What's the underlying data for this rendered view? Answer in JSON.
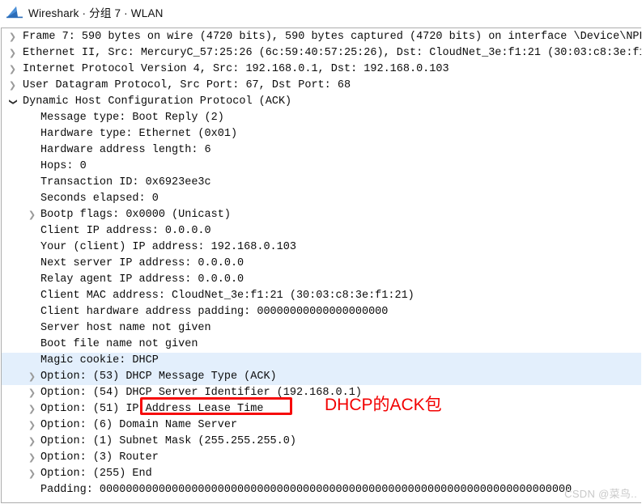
{
  "window": {
    "title": "Wireshark · 分组 7 · WLAN",
    "logo_icon": "wireshark-shark-fin-icon"
  },
  "accent_colors": {
    "selection_blue": "#e3effc",
    "annotation_red": "#f20000",
    "border_gray": "#adadad",
    "chevron_gray": "#9a9a9a",
    "watermark_gray": "#c9c9c9"
  },
  "annotation": {
    "note_text": "DHCP的ACK包",
    "box_target": "DHCP Message Type (ACK)"
  },
  "watermark": {
    "text": "CSDN @菜鸟.."
  },
  "tree": {
    "rows": [
      {
        "depth": 0,
        "toggle": "collapsed",
        "selected": false,
        "text": "Frame 7: 590 bytes on wire (4720 bits), 590 bytes captured (4720 bits) on interface \\Device\\NPF_"
      },
      {
        "depth": 0,
        "toggle": "collapsed",
        "selected": false,
        "text": "Ethernet II, Src: MercuryC_57:25:26 (6c:59:40:57:25:26), Dst: CloudNet_3e:f1:21 (30:03:c8:3e:f1:"
      },
      {
        "depth": 0,
        "toggle": "collapsed",
        "selected": false,
        "text": "Internet Protocol Version 4, Src: 192.168.0.1, Dst: 192.168.0.103"
      },
      {
        "depth": 0,
        "toggle": "collapsed",
        "selected": false,
        "text": "User Datagram Protocol, Src Port: 67, Dst Port: 68"
      },
      {
        "depth": 0,
        "toggle": "expanded",
        "selected": false,
        "text": "Dynamic Host Configuration Protocol (ACK)"
      },
      {
        "depth": 1,
        "toggle": "none",
        "selected": false,
        "text": "Message type: Boot Reply (2)"
      },
      {
        "depth": 1,
        "toggle": "none",
        "selected": false,
        "text": "Hardware type: Ethernet (0x01)"
      },
      {
        "depth": 1,
        "toggle": "none",
        "selected": false,
        "text": "Hardware address length: 6"
      },
      {
        "depth": 1,
        "toggle": "none",
        "selected": false,
        "text": "Hops: 0"
      },
      {
        "depth": 1,
        "toggle": "none",
        "selected": false,
        "text": "Transaction ID: 0x6923ee3c"
      },
      {
        "depth": 1,
        "toggle": "none",
        "selected": false,
        "text": "Seconds elapsed: 0"
      },
      {
        "depth": 1,
        "toggle": "collapsed",
        "selected": false,
        "text": "Bootp flags: 0x0000 (Unicast)"
      },
      {
        "depth": 1,
        "toggle": "none",
        "selected": false,
        "text": "Client IP address: 0.0.0.0"
      },
      {
        "depth": 1,
        "toggle": "none",
        "selected": false,
        "text": "Your (client) IP address: 192.168.0.103"
      },
      {
        "depth": 1,
        "toggle": "none",
        "selected": false,
        "text": "Next server IP address: 0.0.0.0"
      },
      {
        "depth": 1,
        "toggle": "none",
        "selected": false,
        "text": "Relay agent IP address: 0.0.0.0"
      },
      {
        "depth": 1,
        "toggle": "none",
        "selected": false,
        "text": "Client MAC address: CloudNet_3e:f1:21 (30:03:c8:3e:f1:21)"
      },
      {
        "depth": 1,
        "toggle": "none",
        "selected": false,
        "text": "Client hardware address padding: 00000000000000000000"
      },
      {
        "depth": 1,
        "toggle": "none",
        "selected": false,
        "text": "Server host name not given"
      },
      {
        "depth": 1,
        "toggle": "none",
        "selected": false,
        "text": "Boot file name not given"
      },
      {
        "depth": 1,
        "toggle": "none",
        "selected": true,
        "text": "Magic cookie: DHCP"
      },
      {
        "depth": 1,
        "toggle": "collapsed",
        "selected": true,
        "text": "Option: (53) DHCP Message Type (ACK)"
      },
      {
        "depth": 1,
        "toggle": "collapsed",
        "selected": false,
        "text": "Option: (54) DHCP Server Identifier (192.168.0.1)"
      },
      {
        "depth": 1,
        "toggle": "collapsed",
        "selected": false,
        "text": "Option: (51) IP Address Lease Time"
      },
      {
        "depth": 1,
        "toggle": "collapsed",
        "selected": false,
        "text": "Option: (6) Domain Name Server"
      },
      {
        "depth": 1,
        "toggle": "collapsed",
        "selected": false,
        "text": "Option: (1) Subnet Mask (255.255.255.0)"
      },
      {
        "depth": 1,
        "toggle": "collapsed",
        "selected": false,
        "text": "Option: (3) Router"
      },
      {
        "depth": 1,
        "toggle": "collapsed",
        "selected": false,
        "text": "Option: (255) End"
      },
      {
        "depth": 1,
        "toggle": "none",
        "selected": false,
        "text": "Padding: 000000000000000000000000000000000000000000000000000000000000000000000000"
      }
    ]
  }
}
